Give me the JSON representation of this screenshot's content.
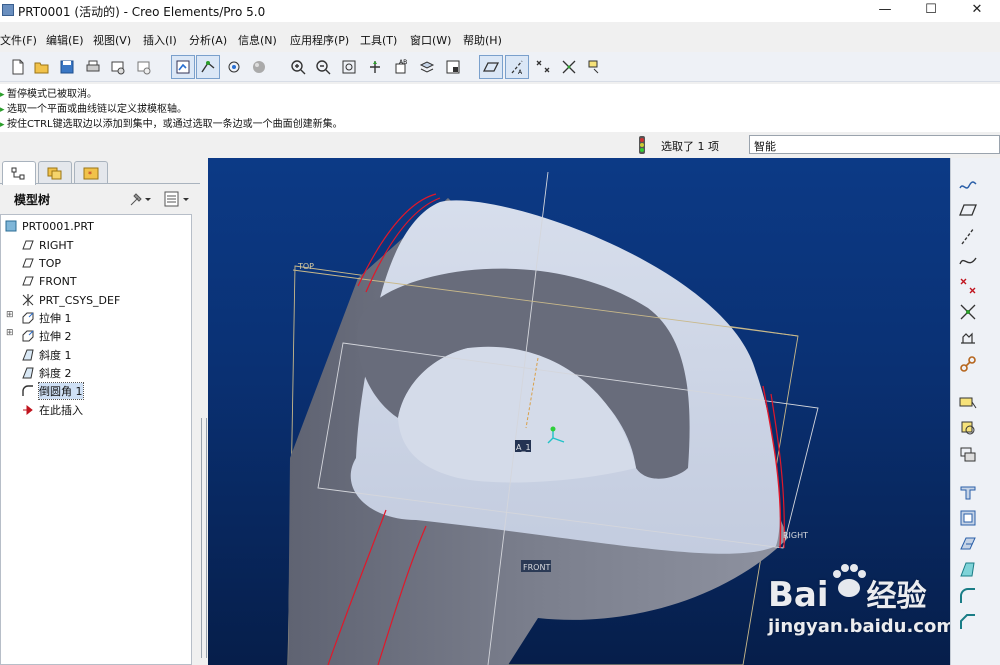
{
  "window": {
    "title": "PRT0001 (活动的) - Creo Elements/Pro 5.0",
    "minimize": "—",
    "maximize": "☐",
    "close": "✕"
  },
  "menu": {
    "items": [
      "文件(F)",
      "编辑(E)",
      "视图(V)",
      "插入(I)",
      "分析(A)",
      "信息(N)",
      "应用程序(P)",
      "工具(T)",
      "窗口(W)",
      "帮助(H)"
    ]
  },
  "messages": [
    "暂停模式已被取消。",
    "选取一个平面或曲线链以定义拔模枢轴。",
    "按住CTRL键选取边以添加到集中，或通过选取一条边或一个曲面创建新集。"
  ],
  "status": {
    "selected_text": "选取了 1 项",
    "filter_value": "智能"
  },
  "model_tree": {
    "header": "模型树",
    "items": [
      {
        "label": "PRT0001.PRT",
        "icon": "part-icon"
      },
      {
        "label": "RIGHT",
        "icon": "datum-plane-icon"
      },
      {
        "label": "TOP",
        "icon": "datum-plane-icon"
      },
      {
        "label": "FRONT",
        "icon": "datum-plane-icon"
      },
      {
        "label": "PRT_CSYS_DEF",
        "icon": "csys-icon"
      },
      {
        "label": "拉伸 1",
        "icon": "extrude-icon"
      },
      {
        "label": "拉伸 2",
        "icon": "extrude-icon"
      },
      {
        "label": "斜度 1",
        "icon": "draft-icon"
      },
      {
        "label": "斜度 2",
        "icon": "draft-icon"
      },
      {
        "label": "倒圆角 1",
        "icon": "round-icon"
      },
      {
        "label": "在此插入",
        "icon": "insert-here-icon"
      }
    ]
  },
  "viewport": {
    "labels": {
      "top": "TOP",
      "right": "RIGHT",
      "front": "FRONT",
      "axis": "A_1"
    }
  },
  "watermark": {
    "brand": "Bai",
    "brand2": "经验",
    "url": "jingyan.baidu.com"
  },
  "colors": {
    "viewport_top": "#0c3a86",
    "viewport_bottom": "#061e4a",
    "model_face": "#c8d2e6",
    "model_side": "#6f7382",
    "edge_highlight": "#e0182a",
    "datum_plane": "#c9b98a"
  }
}
